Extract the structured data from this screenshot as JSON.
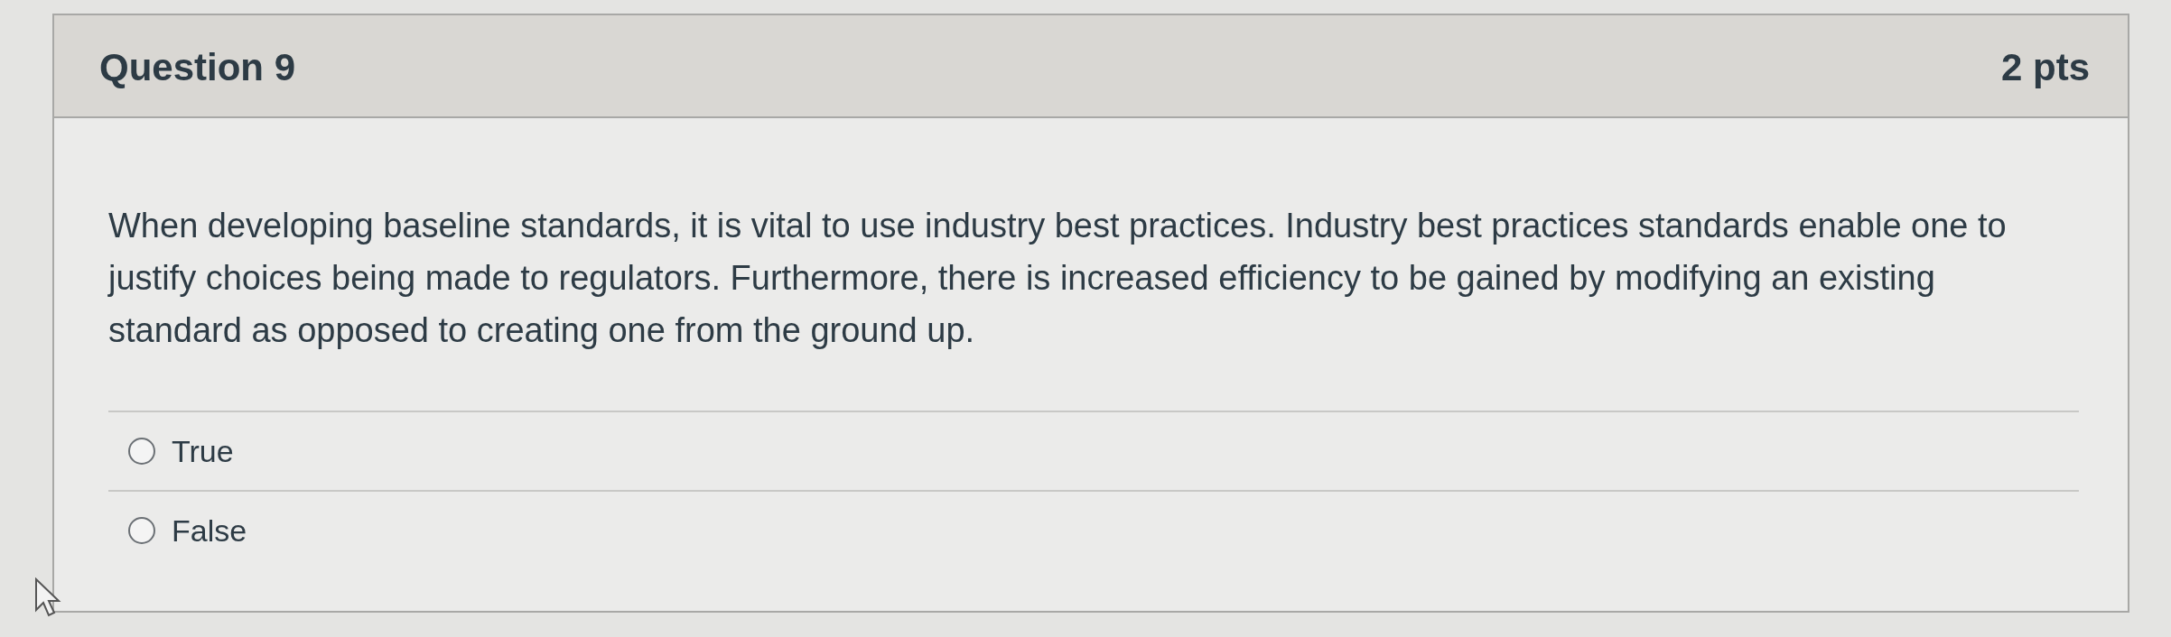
{
  "question": {
    "title": "Question 9",
    "points": "2 pts"
  },
  "prompt": "When developing baseline standards, it is vital to use industry best practices. Industry best practices standards enable one to justify choices being made to regulators. Furthermore, there is increased efficiency to be gained by modifying an existing standard as opposed to creating one from the ground up.",
  "options": [
    {
      "label": "True",
      "selected": false
    },
    {
      "label": "False",
      "selected": false
    }
  ]
}
